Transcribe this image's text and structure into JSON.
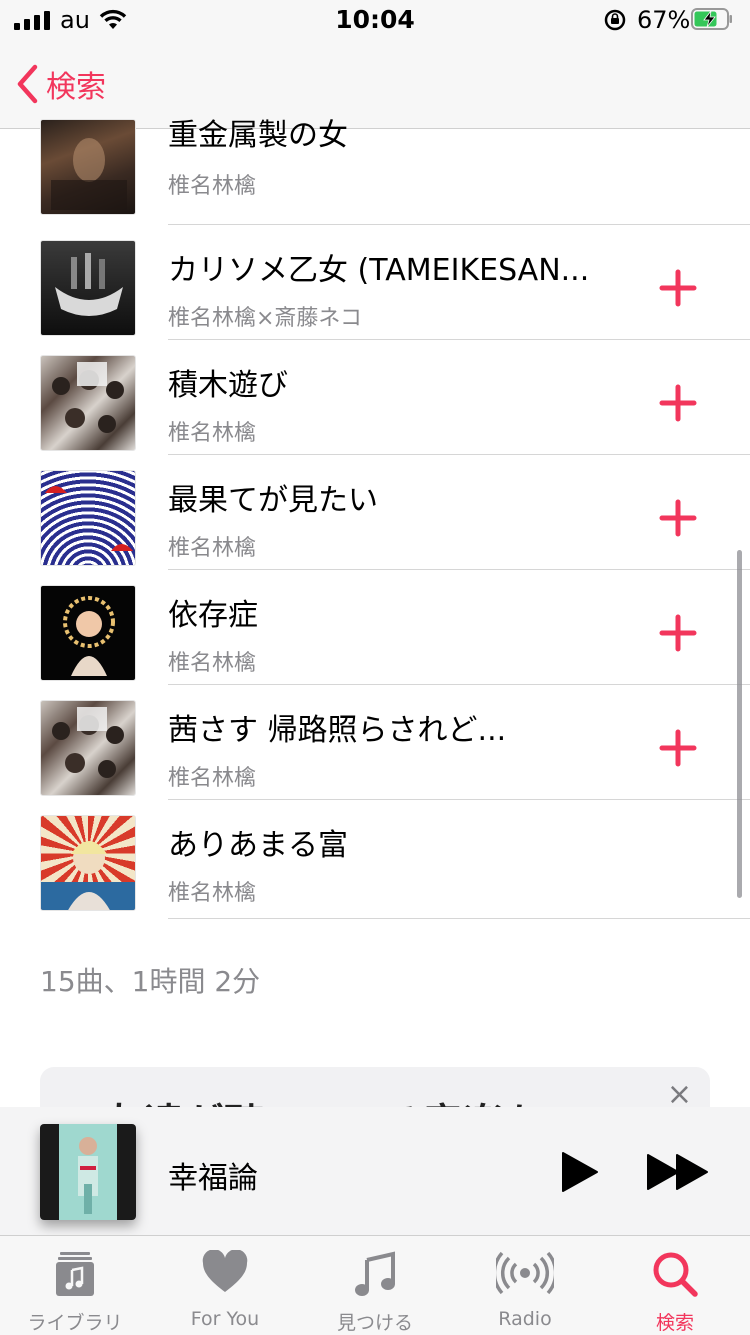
{
  "status": {
    "carrier": "au",
    "time": "10:04",
    "battery_pct": "67%"
  },
  "nav": {
    "back_label": "検索"
  },
  "tracks": [
    {
      "title": "重金属製の女",
      "artist": "椎名林檎",
      "addable": false
    },
    {
      "title": "カリソメ乙女 (TAMEIKESAN...",
      "artist": "椎名林檎×斎藤ネコ",
      "addable": true
    },
    {
      "title": "積木遊び",
      "artist": "椎名林檎",
      "addable": true
    },
    {
      "title": "最果てが見たい",
      "artist": "椎名林檎",
      "addable": true
    },
    {
      "title": "依存症",
      "artist": "椎名林檎",
      "addable": true
    },
    {
      "title": "茜さす 帰路照らされど...",
      "artist": "椎名林檎",
      "addable": true
    },
    {
      "title": "ありあまる富",
      "artist": "椎名林檎",
      "addable": false
    }
  ],
  "summary": "15曲、1時間 2分",
  "banner": {
    "text": "友達が聴いている音楽を"
  },
  "player": {
    "song": "幸福論"
  },
  "tabs": [
    {
      "label": "ライブラリ",
      "icon": "library-icon"
    },
    {
      "label": "For You",
      "icon": "heart-icon"
    },
    {
      "label": "見つける",
      "icon": "music-note-icon"
    },
    {
      "label": "Radio",
      "icon": "radio-icon"
    },
    {
      "label": "検索",
      "icon": "search-icon"
    }
  ],
  "colors": {
    "accent": "#f2365c",
    "secondary_text": "#8a8a8e"
  }
}
